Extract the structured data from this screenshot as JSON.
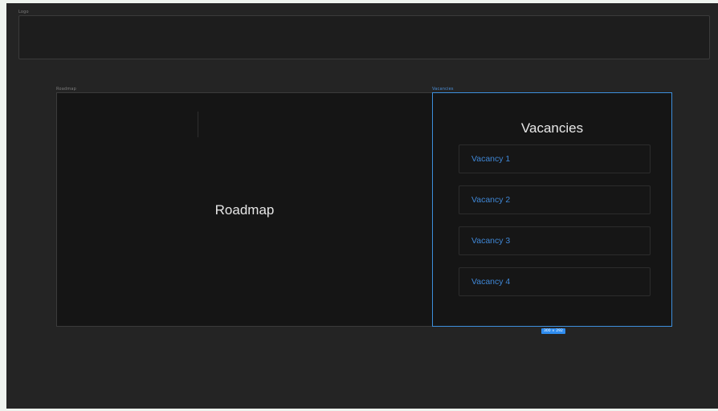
{
  "canvas": {
    "logo_frame": {
      "label": "Logo"
    },
    "roadmap_frame": {
      "label": "Roadmap",
      "title": "Roadmap"
    },
    "vacancies_frame": {
      "label": "Vacancies",
      "title": "Vacancies",
      "items": [
        {
          "label": "Vacancy 1"
        },
        {
          "label": "Vacancy 2"
        },
        {
          "label": "Vacancy 3"
        },
        {
          "label": "Vacancy 4"
        }
      ]
    },
    "selection_size": "300 × 292"
  },
  "colors": {
    "canvas_bg": "#242424",
    "frame_bg": "#151515",
    "selection_accent": "#3d8fdc",
    "link_text": "#3f87d6"
  }
}
